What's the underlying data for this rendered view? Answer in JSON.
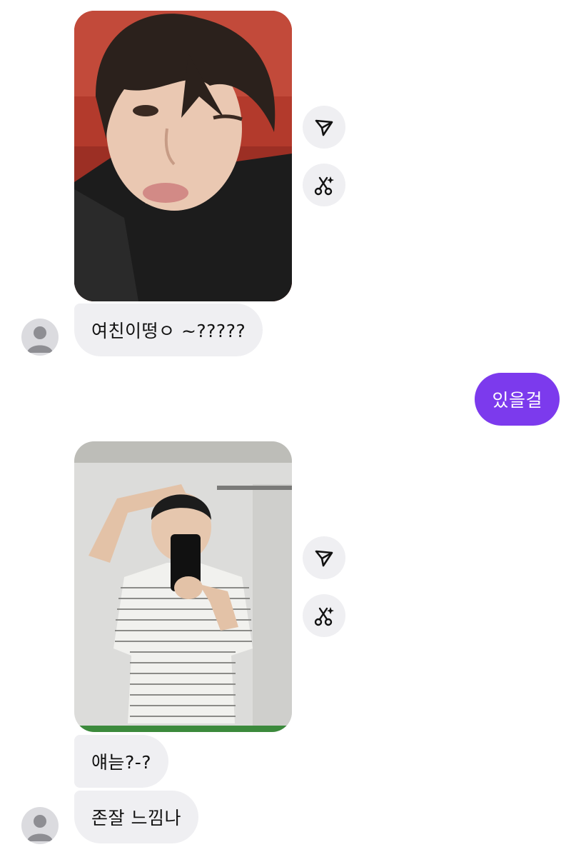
{
  "chat": {
    "messages": [
      {
        "type": "photo",
        "direction": "incoming",
        "description": "selfie with one eye winking"
      },
      {
        "type": "text",
        "direction": "incoming",
        "text": "여친이떵ㅇ ~?????"
      },
      {
        "type": "text",
        "direction": "outgoing",
        "text": "있을걸"
      },
      {
        "type": "photo",
        "direction": "incoming",
        "description": "mirror selfie in striped shirt"
      },
      {
        "type": "text",
        "direction": "incoming",
        "text": "얘늗?-?"
      },
      {
        "type": "text",
        "direction": "incoming",
        "text": "존잘 느낌나"
      }
    ],
    "actions": {
      "share_icon": "share-icon",
      "cutout_icon": "ai-cutout-icon"
    },
    "colors": {
      "outgoing_bubble": "#7c3aed",
      "incoming_bubble": "#efeff2",
      "action_button": "#efeff2"
    }
  }
}
